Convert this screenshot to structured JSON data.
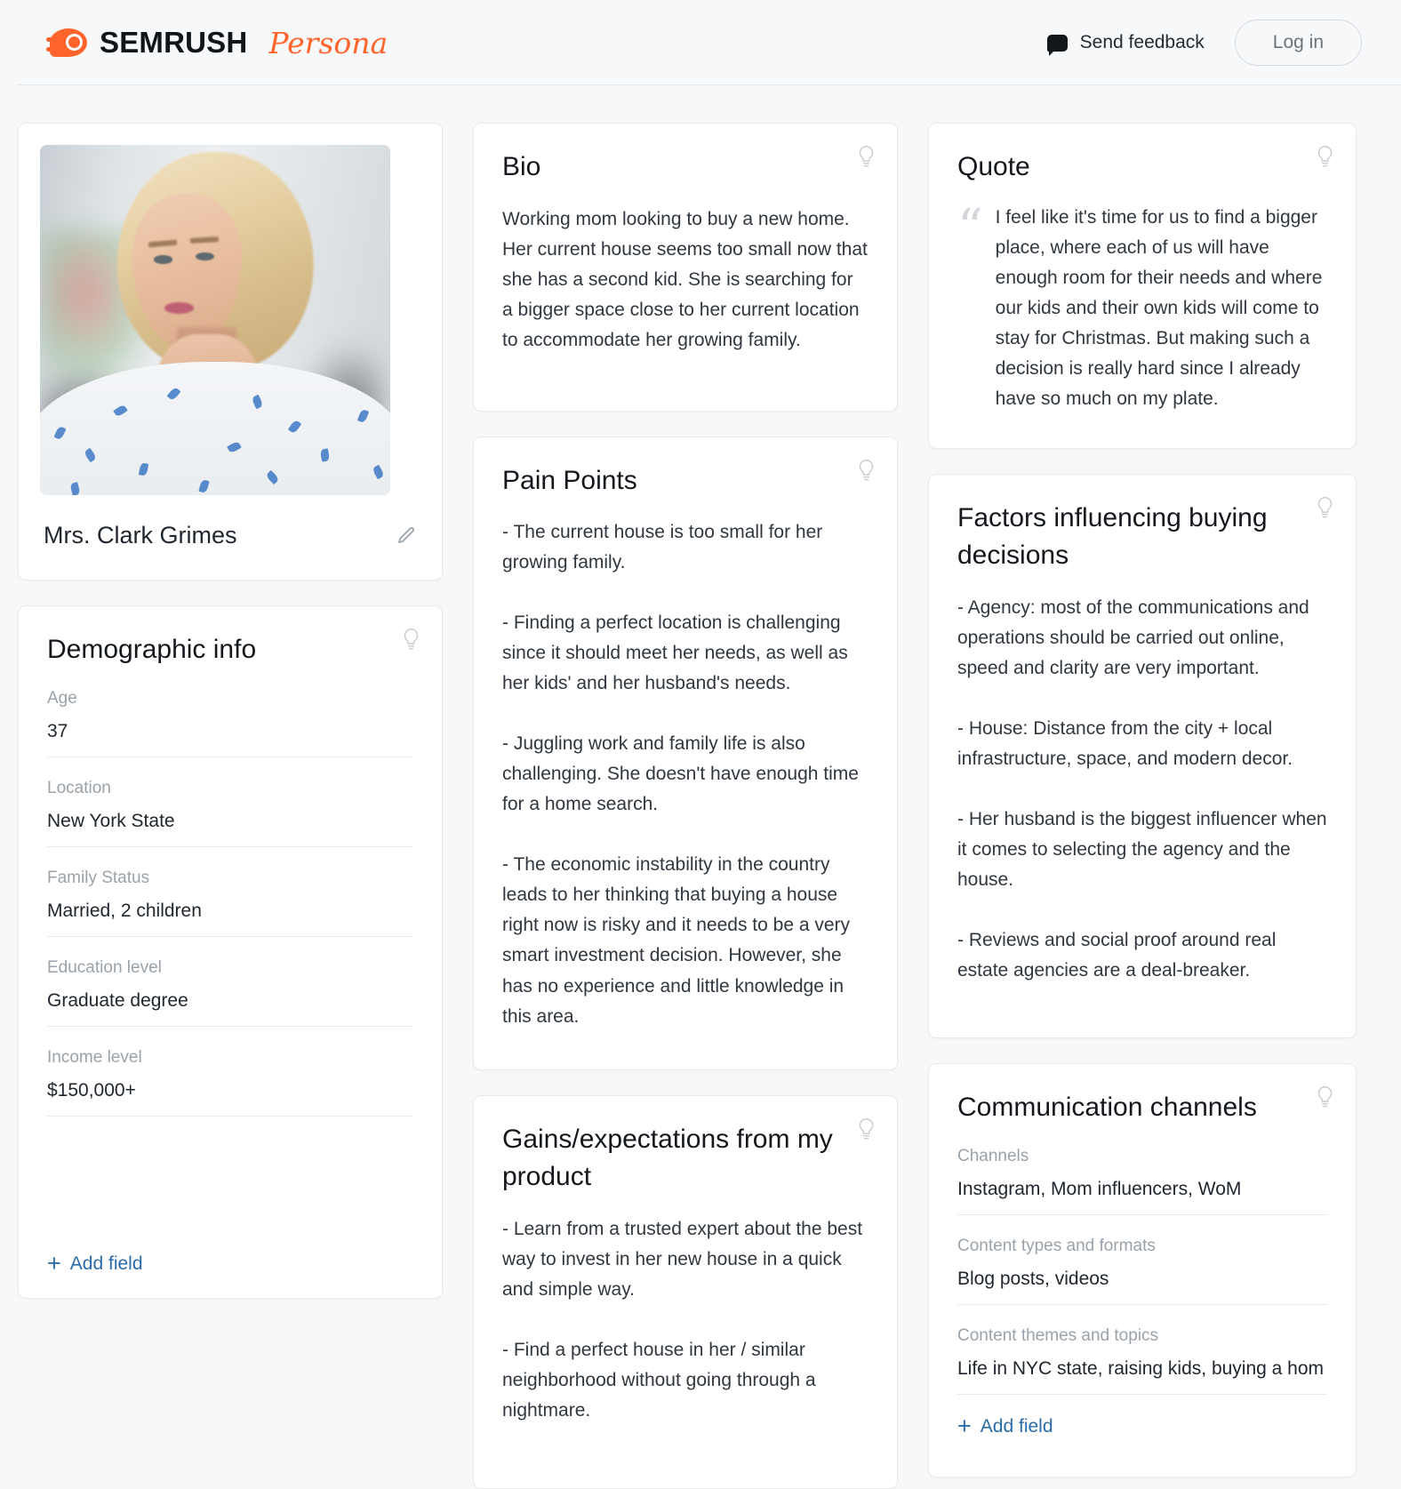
{
  "header": {
    "brand_name": "SEMRUSH",
    "brand_product": "Persona",
    "feedback_label": "Send feedback",
    "login_label": "Log in"
  },
  "profile": {
    "name": "Mrs. Clark Grimes"
  },
  "demographic": {
    "title": "Demographic info",
    "fields": [
      {
        "label": "Age",
        "value": "37"
      },
      {
        "label": "Location",
        "value": "New York State"
      },
      {
        "label": "Family Status",
        "value": "Married, 2 children"
      },
      {
        "label": "Education level",
        "value": "Graduate degree"
      },
      {
        "label": "Income level",
        "value": "$150,000+"
      }
    ],
    "add_field_label": "Add field"
  },
  "bio": {
    "title": "Bio",
    "text": "Working mom looking to buy a new home. Her current house seems too small now that she has a second kid. She is searching for a bigger space close to her current location to accommodate her growing family."
  },
  "pain_points": {
    "title": "Pain Points",
    "text": "- The current house is too small for her growing family.\n\n- Finding a perfect location is challenging since it should meet her needs, as well as her kids' and her husband's needs.\n\n- Juggling work and family life is also challenging. She doesn't have enough time for a home search.\n\n- The economic instability in the country leads to her thinking that buying a house right now is risky and it needs to be a very smart investment decision. However, she has no experience and little knowledge in this area."
  },
  "gains": {
    "title": "Gains/expectations from my product",
    "text": "- Learn from a trusted expert about the best way to invest in her new house in a quick and simple way.\n\n- Find a perfect house in her / similar neighborhood without going through a nightmare."
  },
  "quote": {
    "title": "Quote",
    "mark": "“",
    "text": "I feel like it's time for us to find a bigger place, where each of us will have enough room for their needs and where our kids and their own kids will come to stay for Christmas. But making such a decision is really hard since I already have so much on my plate."
  },
  "factors": {
    "title": "Factors influencing buying decisions",
    "text": "- Agency: most of the communications and operations should be carried out online, speed and clarity are very important.\n\n- House: Distance from the city + local infrastructure, space, and modern decor.\n\n- Her husband is the biggest influencer when it comes to selecting the agency and the house.\n\n- Reviews and social proof around real estate agencies are a deal-breaker."
  },
  "communication": {
    "title": "Communication channels",
    "fields": [
      {
        "label": "Channels",
        "value": "Instagram, Mom influencers, WoM"
      },
      {
        "label": "Content types and formats",
        "value": "Blog posts, videos"
      },
      {
        "label": "Content themes and topics",
        "value": "Life in NYC state, raising kids, buying a hom"
      }
    ],
    "add_field_label": "Add field"
  },
  "colors": {
    "brand_orange": "#ff642d",
    "link_blue": "#2b6ca8",
    "page_bg": "#f7f8f9",
    "card_bg": "#ffffff",
    "card_border": "#e8eaec",
    "label_gray": "#9aa2aa",
    "text_dark": "#20272e"
  },
  "icons": {
    "bulb": "lightbulb-icon",
    "pencil": "pencil-edit-icon",
    "chat": "chat-bubble-icon",
    "plus": "+"
  }
}
